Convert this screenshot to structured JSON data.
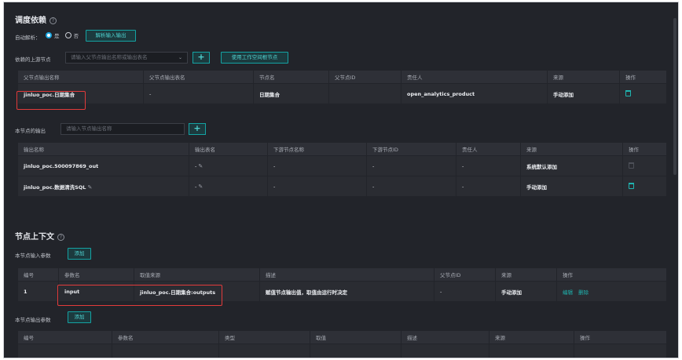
{
  "dep": {
    "title": "调度依赖",
    "auto_parse_label": "自动解析：",
    "yes": "是",
    "no": "否",
    "parse_btn": "解析输入输出",
    "upstream_label": "依赖的上游节点",
    "upstream_placeholder": "请输入父节点输出名称或输出表名",
    "root_btn": "使用工作空间根节点",
    "table": {
      "headers": [
        "父节点输出名称",
        "父节点输出表名",
        "节点名",
        "父节点ID",
        "责任人",
        "来源",
        "操作"
      ],
      "row": [
        "jinluo_poc.日期集合",
        "-",
        "日期集合",
        "",
        "open_analytics_product",
        "手动添加"
      ]
    }
  },
  "out": {
    "label": "本节点的输出",
    "placeholder": "请输入节点输出名称",
    "table": {
      "headers": [
        "输出名称",
        "输出表名",
        "下游节点名称",
        "下游节点ID",
        "责任人",
        "来源",
        "操作"
      ],
      "rows": [
        [
          "jinluo_poc.500097869_out",
          "-",
          "-",
          "-",
          "-",
          "系统默认添加"
        ],
        [
          "jinluo_poc.数据清洗SQL",
          "-",
          "-",
          "-",
          "-",
          "手动添加"
        ]
      ]
    }
  },
  "ctx": {
    "title": "节点上下文",
    "input_label": "本节点输入参数",
    "output_label": "本节点输出参数",
    "add": "添加",
    "in_table": {
      "headers": [
        "编号",
        "参数名",
        "取值来源",
        "描述",
        "父节点ID",
        "来源",
        "操作"
      ],
      "row": [
        "1",
        "input",
        "jinluo_poc.日期集合:outputs",
        "赋值节点输出值，取值由运行时决定",
        "-",
        "手动添加"
      ],
      "edit": "编辑",
      "delete": "删除"
    },
    "out_table": {
      "headers": [
        "编号",
        "参数名",
        "类型",
        "取值",
        "描述",
        "来源",
        "操作"
      ]
    }
  },
  "colors": {
    "background": "#22242a",
    "accent": "#1fb4b0",
    "highlight": "#e23b3b",
    "radio_selected": "#1aa6e0"
  },
  "icons": [
    "help-icon",
    "chevron-down-icon",
    "delete-icon",
    "edit-pencil-icon"
  ]
}
